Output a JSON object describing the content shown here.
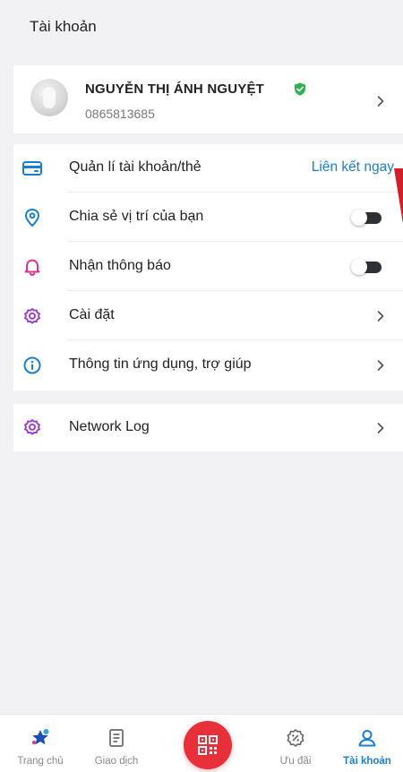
{
  "header": {
    "title": "Tài khoản"
  },
  "profile": {
    "name": "NGUYỄN THỊ ÁNH NGUYỆT",
    "phone": "0865813685"
  },
  "menu": {
    "items": [
      {
        "label": "Quản lí tài khoản/thẻ",
        "action_label": "Liên kết ngay",
        "icon": "card-icon"
      },
      {
        "label": "Chia sẻ vị trí của bạn",
        "icon": "location-pin-icon",
        "toggle": "off"
      },
      {
        "label": "Nhận thông báo",
        "icon": "bell-icon",
        "toggle": "off"
      },
      {
        "label": "Cài đặt",
        "icon": "gear-icon"
      },
      {
        "label": "Thông tin ứng dụng, trợ giúp",
        "icon": "info-icon"
      }
    ]
  },
  "menu2": {
    "items": [
      {
        "label": "Network Log",
        "icon": "gear-icon"
      }
    ]
  },
  "tabbar": {
    "tabs": [
      {
        "label": "Trang chủ",
        "icon": "home-star-icon"
      },
      {
        "label": "Giao dịch",
        "icon": "receipt-icon"
      },
      {
        "label": "",
        "icon": "qr-scan-icon"
      },
      {
        "label": "Ưu đãi",
        "icon": "discount-icon"
      },
      {
        "label": "Tài khoản",
        "icon": "user-icon",
        "active": true
      }
    ]
  },
  "colors": {
    "accent": "#1b7fcf",
    "icon_blue": "#1b7fcf",
    "icon_pink": "#e2338a",
    "icon_purple": "#9b3ad0",
    "verified_green": "#2bb24c",
    "qr_red": "#e8303a"
  }
}
